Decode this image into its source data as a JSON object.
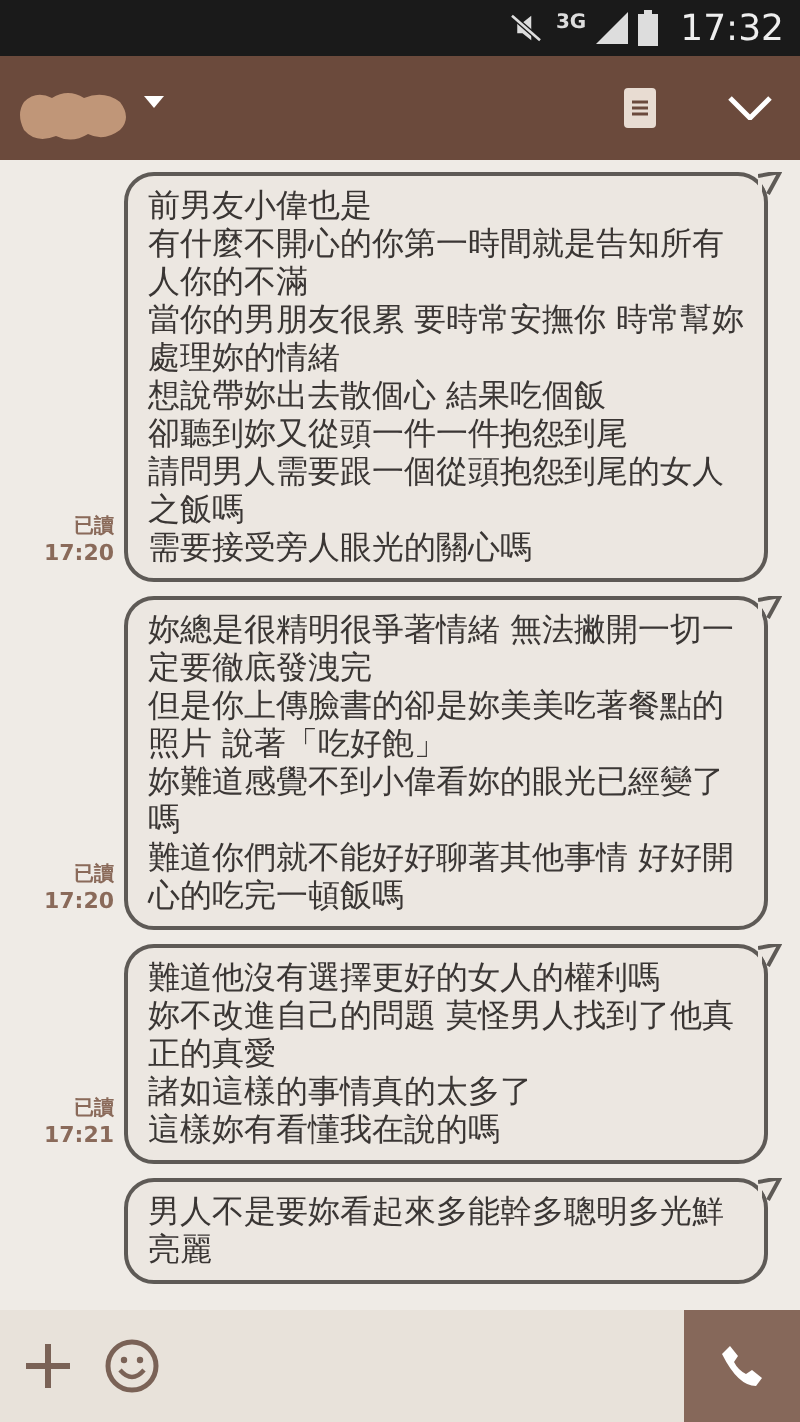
{
  "status_bar": {
    "network": "3G",
    "time": "17:32"
  },
  "header": {
    "name_redacted": true
  },
  "messages": [
    {
      "read": "已讀",
      "time": "17:20",
      "lines": [
        "前男友小偉也是",
        "有什麼不開心的你第一時間就是告知所有",
        "人你的不滿",
        "當你的男朋友很累 要時常安撫你 時常幫妳",
        "處理妳的情緒",
        "想說帶妳出去散個心 結果吃個飯",
        "卻聽到妳又從頭一件一件抱怨到尾",
        "請問男人需要跟一個從頭抱怨到尾的女人",
        "之飯嗎",
        "需要接受旁人眼光的關心嗎"
      ]
    },
    {
      "read": "已讀",
      "time": "17:20",
      "lines": [
        "妳總是很精明很爭著情緒 無法撇開一切一",
        "定要徹底發洩完",
        "但是你上傳臉書的卻是妳美美吃著餐點的",
        "照片 說著「吃好飽」",
        "妳難道感覺不到小偉看妳的眼光已經變了",
        "嗎",
        "難道你們就不能好好聊著其他事情 好好開",
        "心的吃完一頓飯嗎"
      ]
    },
    {
      "read": "已讀",
      "time": "17:21",
      "lines": [
        "難道他沒有選擇更好的女人的權利嗎",
        "妳不改進自己的問題 莫怪男人找到了他真",
        "正的真愛",
        "諸如這樣的事情真的太多了",
        "這樣妳有看懂我在說的嗎"
      ]
    },
    {
      "lines": [
        "男人不是要妳看起來多能幹多聰明多光鮮",
        "亮麗"
      ]
    }
  ]
}
